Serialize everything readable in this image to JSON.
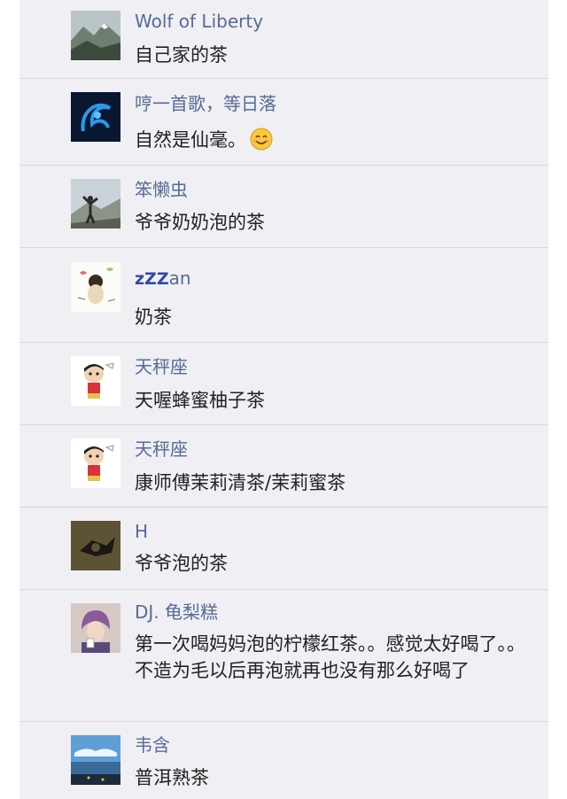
{
  "comments": [
    {
      "name": "Wolf of Liberty",
      "text": "自己家的茶",
      "avatar": "mountain-landscape-avatar"
    },
    {
      "name": "哼一首歌，等日落",
      "text": "自然是仙毫。",
      "emoji": "smiling-face-icon",
      "avatar": "blue-swirl-avatar"
    },
    {
      "name": "笨懒虫",
      "text": "爷爷奶奶泡的茶",
      "avatar": "person-on-mountain-avatar"
    },
    {
      "name_prefix": "zZZ",
      "name": "an",
      "text": "奶茶",
      "avatar": "cartoon-child-avatar"
    },
    {
      "name": "天秤座",
      "text": "天喔蜂蜜柚子茶",
      "avatar": "cartoon-boy-avatar"
    },
    {
      "name": "天秤座",
      "text": "康师傅茉莉清茶/茉莉蜜茶",
      "avatar": "cartoon-boy-avatar"
    },
    {
      "name": "H",
      "text": "爷爷泡的茶",
      "avatar": "dark-object-avatar"
    },
    {
      "name": "DJ. 龟梨糕",
      "text": "第一次喝妈妈泡的柠檬红茶。。感觉太好喝了。。不造为毛以后再泡就再也没有那么好喝了",
      "avatar": "person-portrait-avatar"
    },
    {
      "name": "韦含",
      "text": "普洱熟茶",
      "avatar": "sea-sky-avatar"
    }
  ],
  "colors": {
    "nickname": "#576b95",
    "text": "#222222",
    "background": "#efeff4",
    "divider": "#dadada"
  }
}
